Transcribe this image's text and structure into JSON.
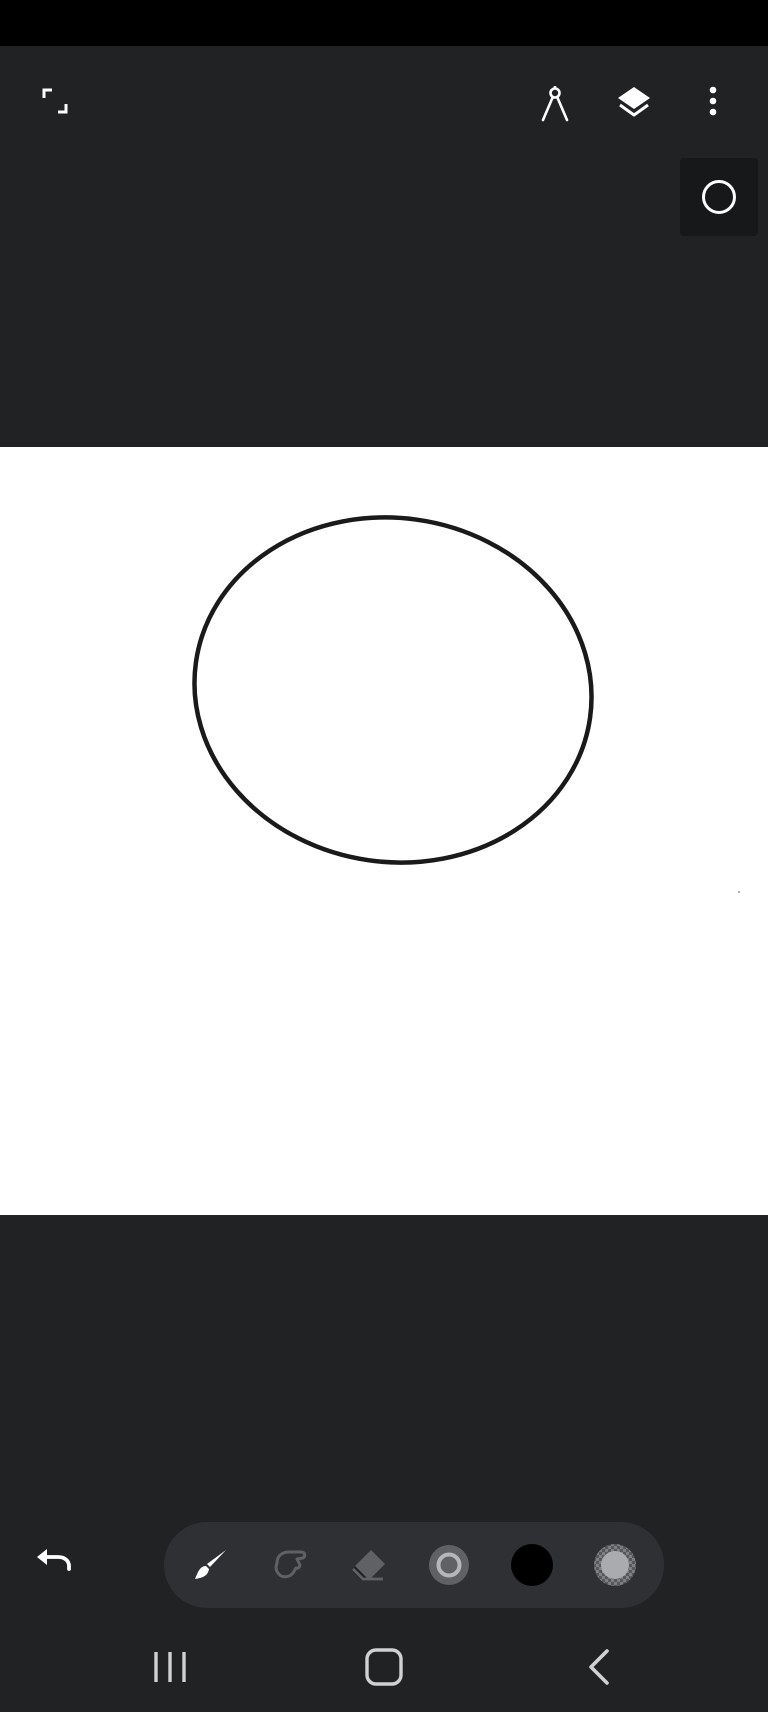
{
  "app": {
    "background_color": "#212224",
    "canvas_color": "#ffffff",
    "stroke_color": "#1a1a1a"
  },
  "top_bar": {
    "icons": [
      "fullscreen-icon",
      "ruler-compass-icon",
      "layers-icon",
      "more-vert-icon"
    ]
  },
  "shape_tool": {
    "icon": "circle-outline-icon",
    "active": true
  },
  "drawing": {
    "shape": "ellipse",
    "stroke": "#1a1a1a"
  },
  "toolbar": {
    "tools": [
      {
        "name": "brush",
        "icon": "brush-icon",
        "active": true
      },
      {
        "name": "smudge",
        "icon": "smudge-icon",
        "active": false
      },
      {
        "name": "eraser",
        "icon": "eraser-icon",
        "active": false
      },
      {
        "name": "brush-size",
        "icon": "brush-size-icon",
        "active": false
      },
      {
        "name": "color",
        "icon": "color-swatch-icon",
        "color": "#000000"
      },
      {
        "name": "opacity",
        "icon": "opacity-icon"
      }
    ]
  },
  "undo": {
    "icon": "undo-icon"
  },
  "nav_bar": {
    "icons": [
      "recents-icon",
      "home-icon",
      "back-icon"
    ]
  }
}
